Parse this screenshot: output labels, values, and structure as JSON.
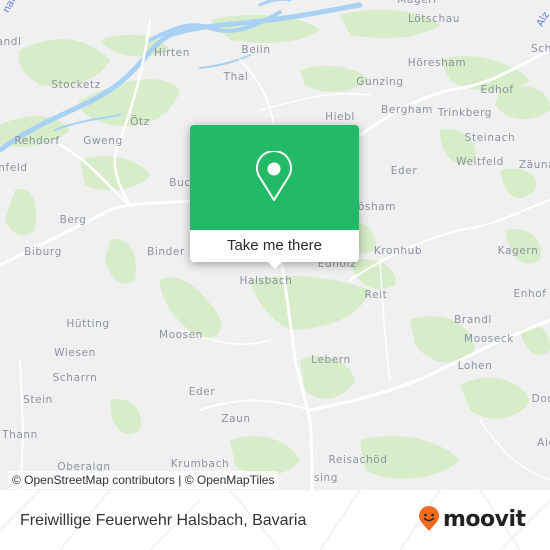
{
  "map": {
    "places": [
      {
        "name": "Hirten",
        "id": "hirten"
      },
      {
        "name": "Beiln",
        "id": "beiln"
      },
      {
        "name": "Thal",
        "id": "thal"
      },
      {
        "name": "Mageri",
        "id": "mageri"
      },
      {
        "name": "Lötschau",
        "id": "loetschau"
      },
      {
        "name": "Höresham",
        "id": "hoeresham"
      },
      {
        "name": "Gunzing",
        "id": "gunzing"
      },
      {
        "name": "Edhof",
        "id": "edhof"
      },
      {
        "name": "Hiebl",
        "id": "hiebl"
      },
      {
        "name": "Bergham",
        "id": "bergham"
      },
      {
        "name": "Trinkberg",
        "id": "trinkberg"
      },
      {
        "name": "Steinach",
        "id": "steinach"
      },
      {
        "name": "Weitfeld",
        "id": "weitfeld"
      },
      {
        "name": "Zäuna",
        "id": "zaeuna"
      },
      {
        "name": "Sche",
        "id": "sche"
      },
      {
        "name": "andl",
        "id": "andl"
      },
      {
        "name": "Stocketz",
        "id": "stocketz"
      },
      {
        "name": "Ötz",
        "id": "oetz"
      },
      {
        "name": "Rehdorf",
        "id": "rehdorf"
      },
      {
        "name": "Gweng",
        "id": "gweng"
      },
      {
        "name": "nfeld",
        "id": "nfeld"
      },
      {
        "name": "Buc",
        "id": "buc"
      },
      {
        "name": "Eder",
        "id": "eder-ne"
      },
      {
        "name": "ösham",
        "id": "oesham"
      },
      {
        "name": "Berg",
        "id": "berg"
      },
      {
        "name": "Biburg",
        "id": "biburg"
      },
      {
        "name": "Binder",
        "id": "binder"
      },
      {
        "name": "Halsbach",
        "id": "halsbach"
      },
      {
        "name": "Edholz",
        "id": "edholz"
      },
      {
        "name": "Kronhub",
        "id": "kronhub"
      },
      {
        "name": "Kagern",
        "id": "kagern"
      },
      {
        "name": "Reit",
        "id": "reit"
      },
      {
        "name": "Enhof",
        "id": "enhof"
      },
      {
        "name": "Hütting",
        "id": "huetting"
      },
      {
        "name": "Moosen",
        "id": "moosen"
      },
      {
        "name": "Brandl",
        "id": "brandl"
      },
      {
        "name": "Mooseck",
        "id": "mooseck"
      },
      {
        "name": "Wiesen",
        "id": "wiesen"
      },
      {
        "name": "Lohen",
        "id": "lohen"
      },
      {
        "name": "Scharrn",
        "id": "scharrn"
      },
      {
        "name": "Lebern",
        "id": "lebern"
      },
      {
        "name": "Eder",
        "id": "eder-sw"
      },
      {
        "name": "Stein",
        "id": "stein"
      },
      {
        "name": "Dor",
        "id": "dor"
      },
      {
        "name": "Zaun",
        "id": "zaun"
      },
      {
        "name": "Thann",
        "id": "thann"
      },
      {
        "name": "Aic",
        "id": "aic"
      },
      {
        "name": "Reisachöd",
        "id": "reisachoed"
      },
      {
        "name": "Krumbach",
        "id": "krumbach"
      },
      {
        "name": "Oberaign",
        "id": "oberaign"
      },
      {
        "name": "sing",
        "id": "sing"
      }
    ],
    "water_labels": [
      {
        "name": "Alz",
        "id": "alz"
      },
      {
        "name": "nal",
        "id": "kanal"
      }
    ],
    "attribution": "© OpenStreetMap contributors | © OpenMapTiles"
  },
  "popup": {
    "button_label": "Take me there",
    "icon": "map-pin-icon",
    "accent_color": "#22b967"
  },
  "footer": {
    "title": "Freiwillige Feuerwehr Halsbach, Bavaria",
    "logo_text": "moovit",
    "logo_icon": "moovit-smiley-pin-icon",
    "brand_color": "#f26b21"
  }
}
